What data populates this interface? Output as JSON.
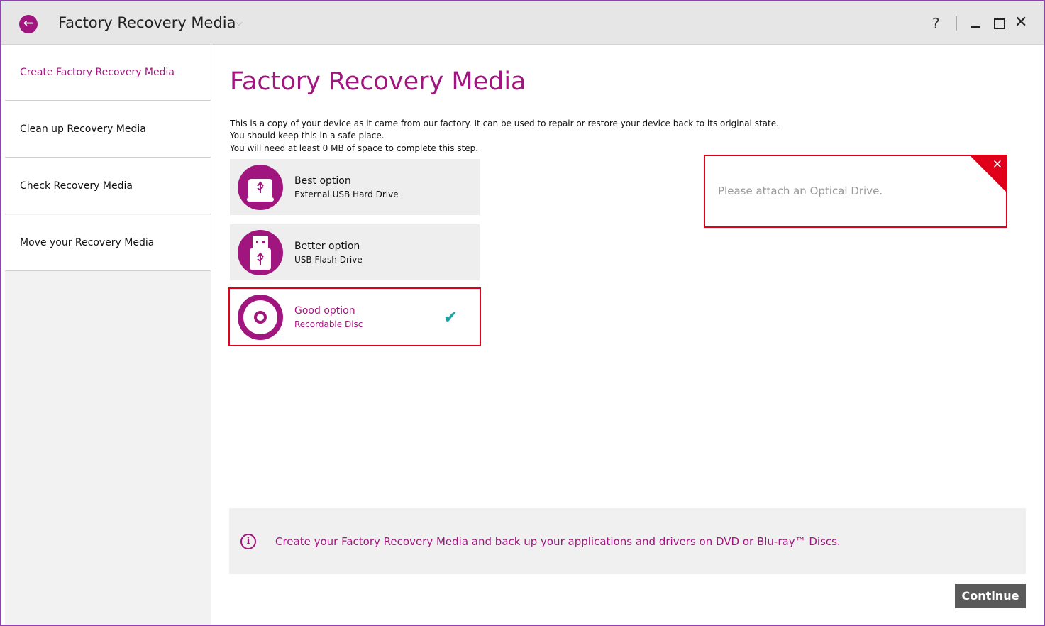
{
  "window": {
    "title": "Factory Recovery Media",
    "accent": "#a1167e",
    "alert_color": "#e0001a",
    "check_color": "#1aa3a3"
  },
  "titlebar": {
    "back_icon": "←",
    "chevron_icon": "⌵",
    "help_label": "?",
    "close_label": "✕"
  },
  "sidebar": {
    "items": [
      {
        "label": "Create Factory Recovery Media",
        "active": true
      },
      {
        "label": "Clean up Recovery Media"
      },
      {
        "label": "Check Recovery Media"
      },
      {
        "label": "Move your Recovery Media"
      }
    ]
  },
  "main": {
    "title": "Factory Recovery Media",
    "description": [
      "This is a copy of your device as it came from our factory. It can be used to repair or restore your device back to its original state.",
      "You should keep this in a safe place.",
      "You will need at least 0 MB of space to complete this step."
    ],
    "options": [
      {
        "title": "Best option",
        "subtitle": "External USB Hard Drive",
        "icon": "usb-hard-drive-icon"
      },
      {
        "title": "Better option",
        "subtitle": "USB Flash Drive",
        "icon": "usb-flash-drive-icon"
      },
      {
        "title": "Good option",
        "subtitle": "Recordable Disc",
        "icon": "disc-icon",
        "selected": true,
        "check": "✔"
      }
    ],
    "alert": {
      "message": "Please attach an Optical Drive.",
      "close": "✕"
    },
    "info": {
      "icon": "i",
      "text": "Create your Factory Recovery Media and back up your applications and drivers on DVD or Blu-ray™ Discs."
    },
    "continue_label": "Continue"
  }
}
